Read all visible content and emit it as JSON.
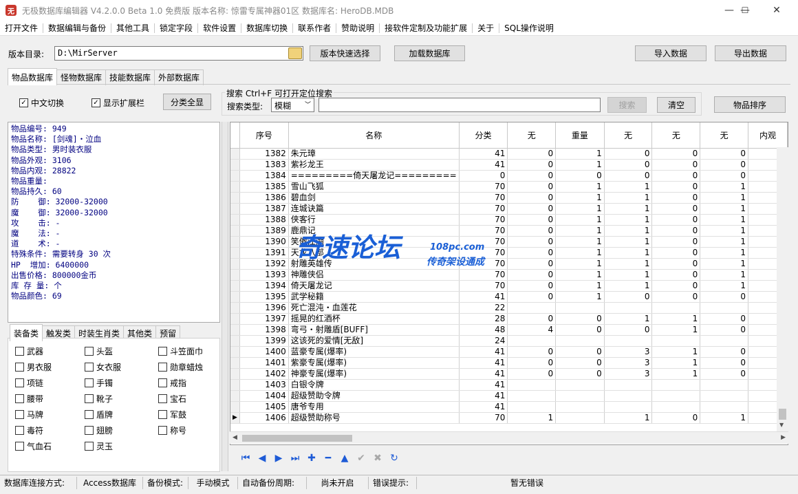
{
  "window": {
    "title": "无极数据库编辑器 V4.2.0.0     Beta 1.0 免费版     版本名称: 惊雷专属神器01区     数据库名: HeroDB.MDB",
    "icon_text": "无",
    "controls": {
      "minimize": "—",
      "maximize": "☐",
      "close": "✕"
    }
  },
  "menu": [
    "打开文件",
    "数据编辑与备份",
    "其他工具",
    "锁定字段",
    "软件设置",
    "数据库切换",
    "联系作者",
    "赞助说明",
    "接软件定制及功能扩展",
    "关于",
    "SQL操作说明"
  ],
  "toolbar": {
    "version_dir_label": "版本目录:",
    "version_dir_value": "D:\\MirServer",
    "quick_select": "版本快速选择",
    "load_db": "加载数据库",
    "import": "导入数据",
    "export": "导出数据"
  },
  "db_tabs": [
    "物品数据库",
    "怪物数据库",
    "技能数据库",
    "外部数据库"
  ],
  "options": {
    "chinese_switch": "中文切换",
    "show_ext": "显示扩展栏",
    "show_all_categories": "分类全显"
  },
  "search": {
    "group_label": "搜索   Ctrl+F 可打开定位搜索",
    "type_label": "搜索类型:",
    "type_value": "模糊",
    "value": "",
    "search_btn": "搜索",
    "clear_btn": "清空",
    "sort_btn": "物品排序"
  },
  "details": [
    "物品编号: 949",
    "物品名称: [剑魂]・泣血",
    "物品类型: 男时装衣服",
    "物品外观: 3106",
    "物品内观: 28822",
    "物品重量:",
    "物品持久: 60",
    "防    御: 32000-32000",
    "魔    御: 32000-32000",
    "攻    击: -",
    "魔    法: -",
    "道    术: -",
    "特殊条件: 需要转身 30 次",
    "HP  增加: 6400000",
    "出售价格: 800000金币",
    "库 存 量: 个",
    "物品颜色: 69"
  ],
  "category_tabs": [
    "装备类",
    "触发类",
    "时装生肖类",
    "其他类",
    "预留"
  ],
  "categories": [
    [
      "武器",
      "头盔",
      "斗笠面巾"
    ],
    [
      "男衣服",
      "女衣服",
      "勋章蜡烛"
    ],
    [
      "项链",
      "手镯",
      "戒指"
    ],
    [
      "腰带",
      "靴子",
      "宝石"
    ],
    [
      "马牌",
      "盾牌",
      "军鼓"
    ],
    [
      "毒符",
      "翅膀",
      "称号"
    ],
    [
      "气血石",
      "灵玉",
      ""
    ]
  ],
  "grid": {
    "columns": [
      "序号",
      "名称",
      "分类",
      "无",
      "重量",
      "无",
      "无",
      "无",
      "内观"
    ],
    "rows": [
      [
        "1382",
        "朱元璋",
        "41",
        "0",
        "1",
        "0",
        "0",
        "0",
        "3"
      ],
      [
        "1383",
        "紫衫龙王",
        "41",
        "0",
        "1",
        "0",
        "0",
        "0",
        "3"
      ],
      [
        "1384",
        "=========倚天屠龙记=========",
        "0",
        "0",
        "0",
        "0",
        "0",
        "0",
        ""
      ],
      [
        "1385",
        "雪山飞狐",
        "70",
        "0",
        "1",
        "1",
        "0",
        "1",
        "9"
      ],
      [
        "1386",
        "碧血剑",
        "70",
        "0",
        "1",
        "1",
        "0",
        "1",
        "9"
      ],
      [
        "1387",
        "连城诀篇",
        "70",
        "0",
        "1",
        "1",
        "0",
        "1",
        "9"
      ],
      [
        "1388",
        "侠客行",
        "70",
        "0",
        "1",
        "1",
        "0",
        "1",
        "9"
      ],
      [
        "1389",
        "鹿鼎记",
        "70",
        "0",
        "1",
        "1",
        "0",
        "1",
        "9"
      ],
      [
        "1390",
        "笑傲江湖",
        "70",
        "0",
        "1",
        "1",
        "0",
        "1",
        "9"
      ],
      [
        "1391",
        "天龙八部",
        "70",
        "0",
        "1",
        "1",
        "0",
        "1",
        "9"
      ],
      [
        "1392",
        "射雕英雄传",
        "70",
        "0",
        "1",
        "1",
        "0",
        "1",
        "9"
      ],
      [
        "1393",
        "神雕侠侣",
        "70",
        "0",
        "1",
        "1",
        "0",
        "1",
        "9"
      ],
      [
        "1394",
        "倚天屠龙记",
        "70",
        "0",
        "1",
        "1",
        "0",
        "1",
        "9"
      ],
      [
        "1395",
        "武学秘籍",
        "41",
        "0",
        "1",
        "0",
        "0",
        "0",
        "3"
      ],
      [
        "1396",
        "死亡混沌・血莲花",
        "22",
        "",
        "",
        "",
        "",
        "",
        "2"
      ],
      [
        "1397",
        "摇晃的红酒杯",
        "28",
        "0",
        "0",
        "1",
        "1",
        "0",
        "1"
      ],
      [
        "1398",
        "弯弓・射雕盾[BUFF]",
        "48",
        "4",
        "0",
        "0",
        "1",
        "0",
        "3"
      ],
      [
        "1399",
        "这该死的爱情[无敌]",
        "24",
        "",
        "",
        "",
        "",
        "",
        "1"
      ],
      [
        "1400",
        "蓝豪专属(爆率)",
        "41",
        "0",
        "0",
        "3",
        "1",
        "0",
        "2"
      ],
      [
        "1401",
        "紫豪专属(爆率)",
        "41",
        "0",
        "0",
        "3",
        "1",
        "0",
        "2"
      ],
      [
        "1402",
        "神豪专属(爆率)",
        "41",
        "0",
        "0",
        "3",
        "1",
        "0",
        "2"
      ],
      [
        "1403",
        "白银令牌",
        "41",
        "",
        "",
        "",
        "",
        "",
        "1"
      ],
      [
        "1404",
        "超级赞助令牌",
        "41",
        "",
        "",
        "",
        "",
        "",
        "1"
      ],
      [
        "1405",
        "唐爷专用",
        "41",
        "",
        "",
        "",
        "",
        "",
        "1"
      ],
      [
        "1406",
        "超级赞助称号",
        "70",
        "1",
        "",
        "1",
        "0",
        "1",
        "1"
      ]
    ],
    "current_row_index": 24
  },
  "nav_icons": [
    "first-icon",
    "prev-icon",
    "next-icon",
    "last-icon",
    "add-icon",
    "delete-icon",
    "up-icon",
    "confirm-icon",
    "cancel-icon",
    "refresh-icon"
  ],
  "watermark": {
    "main": "奇速论坛",
    "site": "108pc.com",
    "sub": "传奇架设通成"
  },
  "status": {
    "conn_label": "数据库连接方式:",
    "conn_value": "Access数据库",
    "backup_label": "备份模式:",
    "backup_value": "手动模式",
    "auto_label": "自动备份周期:",
    "auto_value": "尚未开启",
    "error_label": "错误提示:",
    "error_value": "暂无错误"
  },
  "colors": {
    "detail_text": "#000080",
    "nav_icon": "#1e5bd6",
    "watermark": "#1a5fd6"
  }
}
